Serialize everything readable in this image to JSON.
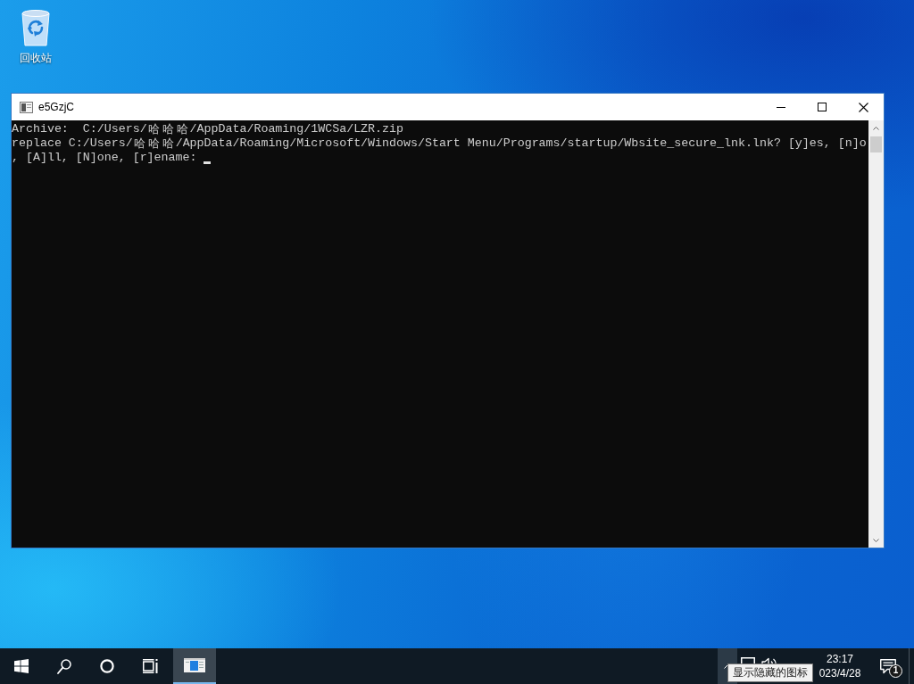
{
  "desktop": {
    "icons": [
      {
        "kind": "recycle_bin",
        "label": "回收站"
      }
    ]
  },
  "window": {
    "title": "e5GzjC",
    "console": {
      "lines": [
        "Archive:  C:/Users/哈哈哈/AppData/Roaming/1WCSa/LZR.zip",
        "replace C:/Users/哈哈哈/AppData/Roaming/Microsoft/Windows/Start Menu/Programs/startup/Wbsite_secure_lnk.lnk? [y]es, [n]o",
        ", [A]ll, [N]one, [r]ename:"
      ],
      "cursor": true
    }
  },
  "taskbar": {
    "buttons": [
      {
        "kind": "start"
      },
      {
        "kind": "search"
      },
      {
        "kind": "cortana"
      },
      {
        "kind": "task_view"
      }
    ],
    "apps": [
      {
        "kind": "console",
        "selected": true
      }
    ],
    "tray": {
      "show_hidden_button": {
        "highlighted": true
      },
      "tooltip": "显示隐藏的图标",
      "icons": [
        {
          "kind": "network"
        },
        {
          "kind": "volume"
        }
      ],
      "time": "23:17",
      "date": "023/4/28",
      "notifications": {
        "badge": "1"
      }
    }
  }
}
